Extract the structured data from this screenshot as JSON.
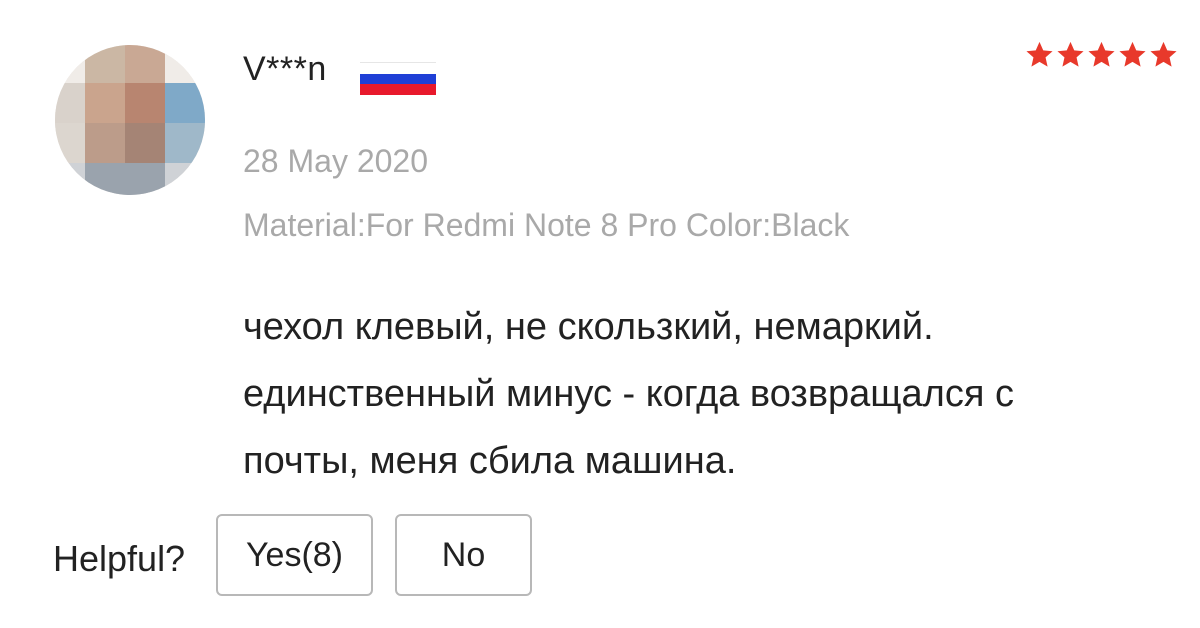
{
  "review": {
    "avatar_icon": "blurred-user-photo",
    "username": "V***n",
    "country_flag": {
      "icon": "russia-flag-icon",
      "colors": [
        "#ffffff",
        "#1f3fd6",
        "#e8192c"
      ]
    },
    "rating": {
      "value": 5,
      "max": 5,
      "star_color": "#e8392b"
    },
    "date": "28 May 2020",
    "sku_line": "Material:For Redmi Note 8 Pro Color:Black",
    "text_lines": [
      "чехол клевый, не скользкий, немаркий.",
      "единственный минус - когда возвращался с",
      "почты, меня сбила машина."
    ]
  },
  "helpful": {
    "label": "Helpful?",
    "yes_label": "Yes(8)",
    "no_label": "No"
  }
}
